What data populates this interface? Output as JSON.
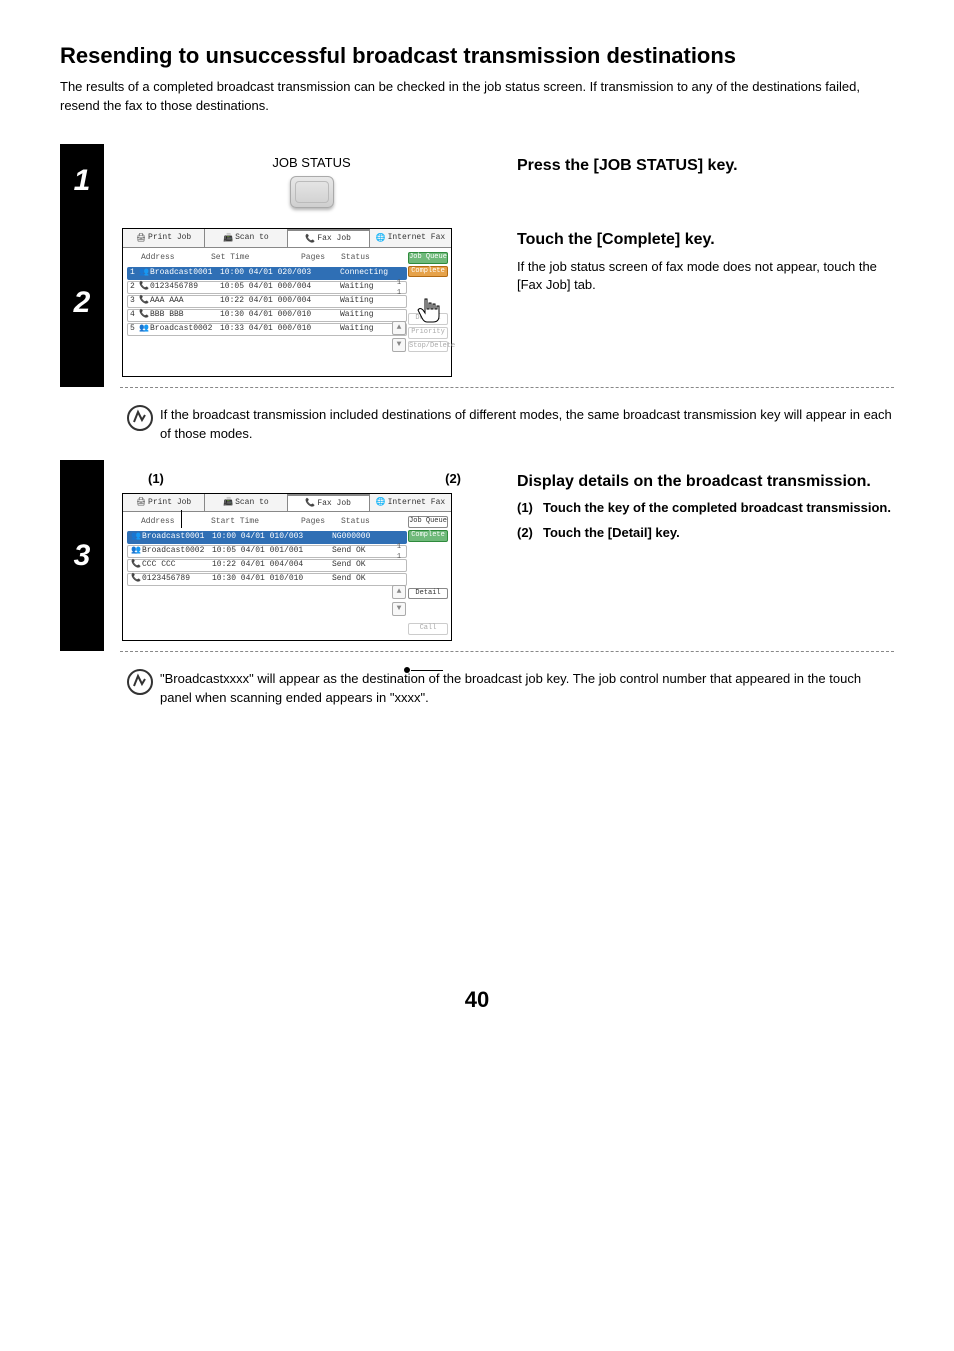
{
  "page": {
    "title": "Resending to unsuccessful broadcast transmission destinations",
    "intro": "The results of a completed broadcast transmission can be checked in the job status screen. If transmission to any of the destinations failed, resend the fax to those destinations.",
    "footer_page_number": "40"
  },
  "step1": {
    "number": "1",
    "hw_key_label": "JOB STATUS",
    "instruction_heading": "Press the [JOB STATUS] key."
  },
  "step2": {
    "number": "2",
    "instruction_heading": "Touch the [Complete] key.",
    "instruction_body": "If the job status screen of fax mode does not appear, touch the [Fax Job] tab.",
    "tip": "If the broadcast transmission included destinations of different modes, the same broadcast transmission key will appear in each of those modes.",
    "panel": {
      "tabs": [
        "Print Job",
        "Scan to",
        "Fax Job",
        "Internet Fax"
      ],
      "active_tab": 2,
      "headers": {
        "address": "Address",
        "time": "Set Time",
        "pages": "Pages",
        "status": "Status"
      },
      "rows": [
        {
          "n": "1",
          "icon": "group",
          "addr": "Broadcast0001",
          "time": "10:00 04/01",
          "pages": "020/003",
          "status": "Connecting",
          "sel": true
        },
        {
          "n": "2",
          "icon": "phone",
          "addr": "0123456789",
          "time": "10:05 04/01",
          "pages": "000/004",
          "status": "Waiting"
        },
        {
          "n": "3",
          "icon": "phone",
          "addr": "AAA AAA",
          "time": "10:22 04/01",
          "pages": "000/004",
          "status": "Waiting"
        },
        {
          "n": "4",
          "icon": "phone",
          "addr": "BBB BBB",
          "time": "10:30 04/01",
          "pages": "000/010",
          "status": "Waiting"
        },
        {
          "n": "5",
          "icon": "group",
          "addr": "Broadcast0002",
          "time": "10:33 04/01",
          "pages": "000/010",
          "status": "Waiting"
        }
      ],
      "page_indicator": {
        "cur": "1",
        "total": "1"
      },
      "side_buttons": {
        "queue": "Job Queue",
        "complete": "Complete",
        "detail": "Detail",
        "priority": "Priority",
        "stopdel": "Stop/Delete"
      }
    }
  },
  "step3": {
    "number": "3",
    "callouts": {
      "c1": "(1)",
      "c2": "(2)"
    },
    "instruction_heading": "Display details on the broadcast transmission.",
    "sub1_num": "(1)",
    "sub1": "Touch the key of the completed broadcast transmission.",
    "sub2_num": "(2)",
    "sub2": "Touch the [Detail] key.",
    "tip": "\"Broadcastxxxx\" will appear as the destination of the broadcast job key. The job control number that appeared in the touch panel when scanning ended appears in \"xxxx\".",
    "panel": {
      "tabs": [
        "Print Job",
        "Scan to",
        "Fax Job",
        "Internet Fax"
      ],
      "active_tab": 2,
      "headers": {
        "address": "Address",
        "time": "Start Time",
        "pages": "Pages",
        "status": "Status"
      },
      "rows": [
        {
          "icon": "group",
          "addr": "Broadcast0001",
          "time": "10:00 04/01",
          "pages": "010/003",
          "status": "NG000000",
          "sel": true
        },
        {
          "icon": "group",
          "addr": "Broadcast0002",
          "time": "10:05 04/01",
          "pages": "001/001",
          "status": "Send OK"
        },
        {
          "icon": "phone",
          "addr": "CCC CCC",
          "time": "10:22 04/01",
          "pages": "004/004",
          "status": "Send OK"
        },
        {
          "icon": "phone",
          "addr": "0123456789",
          "time": "10:30 04/01",
          "pages": "010/010",
          "status": "Send OK"
        }
      ],
      "page_indicator": {
        "cur": "1",
        "total": "1"
      },
      "side_buttons": {
        "queue": "Job Queue",
        "complete": "Complete",
        "detail": "Detail",
        "call": "Call"
      }
    }
  }
}
